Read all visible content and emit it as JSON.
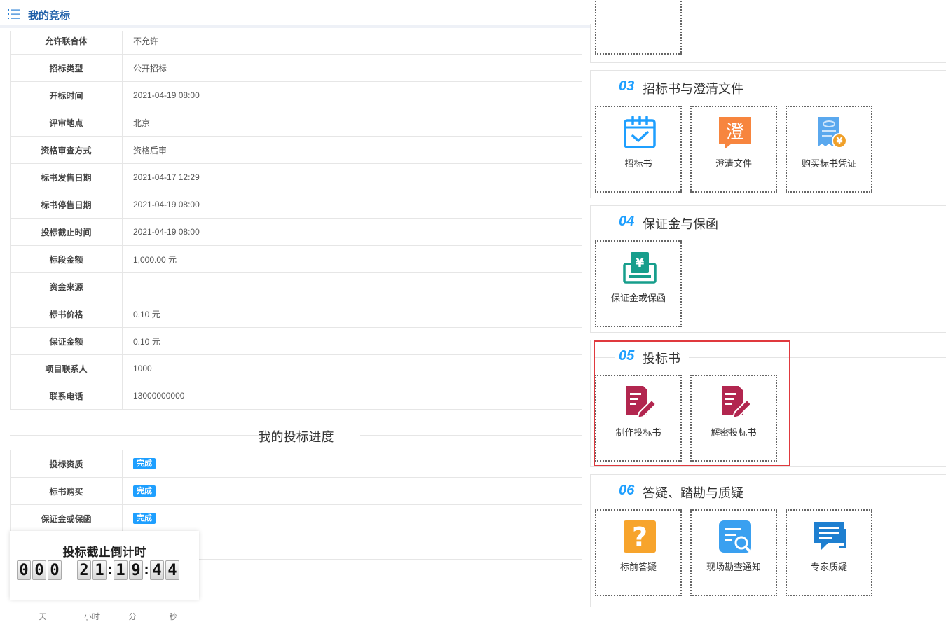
{
  "header": {
    "title": "我的竞标",
    "menu_icon": "list-icon"
  },
  "info_rows": [
    {
      "label": "允许联合体",
      "value": "不允许"
    },
    {
      "label": "招标类型",
      "value": "公开招标"
    },
    {
      "label": "开标时间",
      "value": "2021-04-19 08:00"
    },
    {
      "label": "评审地点",
      "value": "北京"
    },
    {
      "label": "资格审查方式",
      "value": "资格后审"
    },
    {
      "label": "标书发售日期",
      "value": "2021-04-17 12:29"
    },
    {
      "label": "标书停售日期",
      "value": "2021-04-19 08:00"
    },
    {
      "label": "投标截止时间",
      "value": "2021-04-19 08:00"
    },
    {
      "label": "标段金额",
      "value": "1,000.00 元"
    },
    {
      "label": "资金来源",
      "value": ""
    },
    {
      "label": "标书价格",
      "value": "0.10 元"
    },
    {
      "label": "保证金额",
      "value": "0.10 元"
    },
    {
      "label": "项目联系人",
      "value": "1000"
    },
    {
      "label": "联系电话",
      "value": "13000000000"
    }
  ],
  "progress": {
    "title": "我的投标进度",
    "rows": [
      {
        "label": "投标资质",
        "status": "完成"
      },
      {
        "label": "标书购买",
        "status": "完成"
      },
      {
        "label": "保证金或保函",
        "status": "完成"
      },
      {
        "label": "",
        "status": ""
      }
    ]
  },
  "countdown": {
    "title": "投标截止倒计时",
    "days": [
      "0",
      "0",
      "0"
    ],
    "hours": [
      "2",
      "1"
    ],
    "minutes": [
      "1",
      "9"
    ],
    "seconds": [
      "4",
      "4"
    ],
    "unit_day": "天",
    "unit_hour": "小时",
    "unit_minute": "分",
    "unit_second": "秒"
  },
  "sections": [
    {
      "num": "03",
      "name": "招标书与澄清文件",
      "tiles": [
        {
          "label": "招标书",
          "icon": "calendar-check-icon"
        },
        {
          "label": "澄清文件",
          "icon": "clarify-chat-icon",
          "glyph": "澄"
        },
        {
          "label": "购买标书凭证",
          "icon": "receipt-yuan-icon"
        }
      ]
    },
    {
      "num": "04",
      "name": "保证金与保函",
      "tiles": [
        {
          "label": "保证金或保函",
          "icon": "deposit-box-icon"
        }
      ]
    },
    {
      "num": "05",
      "name": "投标书",
      "tiles": [
        {
          "label": "制作投标书",
          "icon": "edit-document-icon"
        },
        {
          "label": "解密投标书",
          "icon": "decrypt-document-icon"
        }
      ]
    },
    {
      "num": "06",
      "name": "答疑、踏勘与质疑",
      "tiles": [
        {
          "label": "标前答疑",
          "icon": "question-icon",
          "glyph": "?"
        },
        {
          "label": "现场勘查通知",
          "icon": "search-document-icon"
        },
        {
          "label": "专家质疑",
          "icon": "chat-bubble-icon"
        }
      ]
    }
  ],
  "colors": {
    "accent": "#1e9fff",
    "title": "#1f5fa8",
    "highlight": "#e0393e",
    "bid_icon": "#b2264f",
    "orange": "#f7853e",
    "teal": "#179e8c"
  }
}
